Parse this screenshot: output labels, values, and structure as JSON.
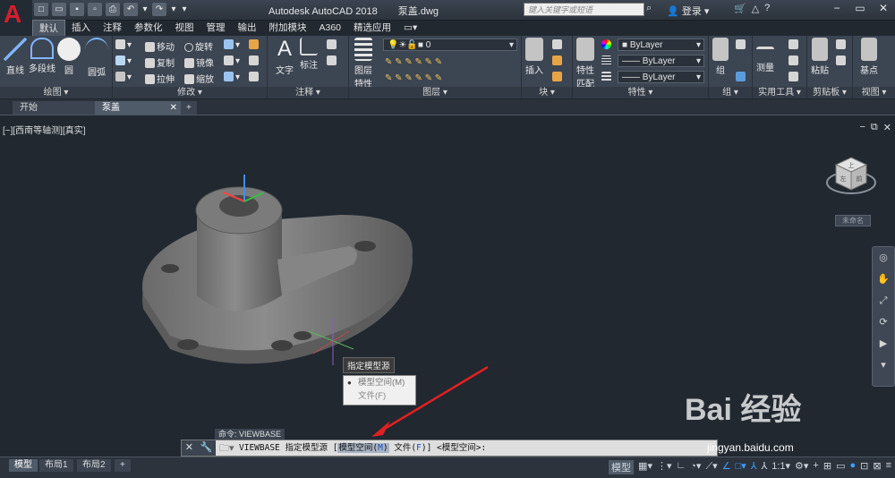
{
  "app": {
    "title": "Autodesk AutoCAD 2018",
    "file": "泵盖.dwg"
  },
  "search": {
    "placeholder": "键入关键字或短语"
  },
  "login_label": "登录",
  "menu_tabs": [
    "默认",
    "插入",
    "注释",
    "参数化",
    "视图",
    "管理",
    "输出",
    "附加模块",
    "A360",
    "精选应用"
  ],
  "panels": {
    "draw": {
      "title": "绘图",
      "line": "直线",
      "polyline": "多段线",
      "circle": "圆",
      "arc": "圆弧"
    },
    "modify": {
      "title": "修改",
      "move": "移动",
      "rotate": "旋转",
      "copy": "复制",
      "mirror": "镜像",
      "stretch": "拉伸",
      "scale": "缩放"
    },
    "annotation": {
      "title": "注释",
      "text": "文字",
      "dimension": "标注"
    },
    "layers": {
      "title": "图层",
      "props": "图层\n特性",
      "layer_value": "0"
    },
    "block": {
      "title": "块",
      "insert": "插入"
    },
    "properties": {
      "title": "特性",
      "match": "特性\n匹配",
      "color": "ByLayer",
      "linetype": "ByLayer",
      "lineweight": "ByLayer"
    },
    "groups": {
      "title": "组",
      "group": "组"
    },
    "utilities": {
      "title": "实用工具",
      "measure": "测量"
    },
    "clipboard": {
      "title": "剪贴板",
      "paste": "粘贴"
    },
    "view": {
      "title": "视图",
      "base": "基点"
    }
  },
  "doc_tabs": [
    "开始",
    "泵盖"
  ],
  "viewport_label": "[−][西南等轴测][真实]",
  "viewcube": {
    "top": "上",
    "left": "左",
    "front": "前",
    "wcs": "未命名"
  },
  "tooltip": "指定模型源",
  "dropdown": [
    "模型空间(M)",
    "文件(F)"
  ],
  "command": {
    "history": "命令: VIEWBASE",
    "cmd": "VIEWBASE 指定模型源 [",
    "opt1": "模型空间(",
    "opt1_key": "M",
    "opt1_end": ")",
    "opt2": "文件(",
    "opt2_key": "F",
    "opt2_end": ")",
    "tail": "] <模型空间>:"
  },
  "layout_tabs": [
    "模型",
    "布局1",
    "布局2"
  ],
  "status": {
    "model": "模型",
    "scale": "1:1"
  },
  "watermark": {
    "text": "Bai 经验",
    "url": "jingyan.baidu.com"
  }
}
